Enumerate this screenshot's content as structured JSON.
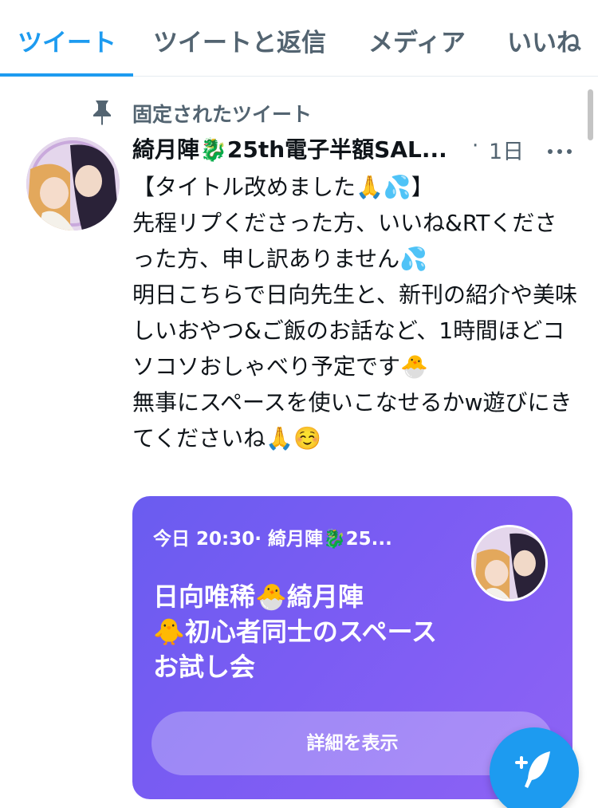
{
  "tabs": [
    {
      "label": "ツイート",
      "active": true
    },
    {
      "label": "ツイートと返信",
      "active": false
    },
    {
      "label": "メディア",
      "active": false
    },
    {
      "label": "いいね",
      "active": false
    }
  ],
  "tweet": {
    "pinned_label": "固定されたツイート",
    "author": "綺月陣🐉25th電子半額SAL...",
    "separator": "·",
    "time": "1日",
    "body": "【タイトル改めました🙏💦】\n先程リプくださった方、いいね&RTくださった方、申し訳ありません💦\n明日こちらで日向先生と、新刊の紹介や美味しいおやつ&ご飯のお話など、1時間ほどコソコソおしゃべり予定です🐣\n無事にスペースを使いこなせるかw遊びにきてくださいね🙏☺️"
  },
  "space": {
    "meta": "今日 20:30· 綺月陣🐉25...",
    "title": "日向唯稀🐣綺月陣\n🐥初心者同士のスペースお試し会",
    "details_label": "詳細を表示"
  },
  "icons": {
    "pin": "pin-icon",
    "more": "more-icon",
    "compose": "compose-tweet-icon"
  },
  "colors": {
    "accent": "#1d9bf0",
    "secondary_text": "#536471",
    "space_card": "#7b5cf3"
  }
}
